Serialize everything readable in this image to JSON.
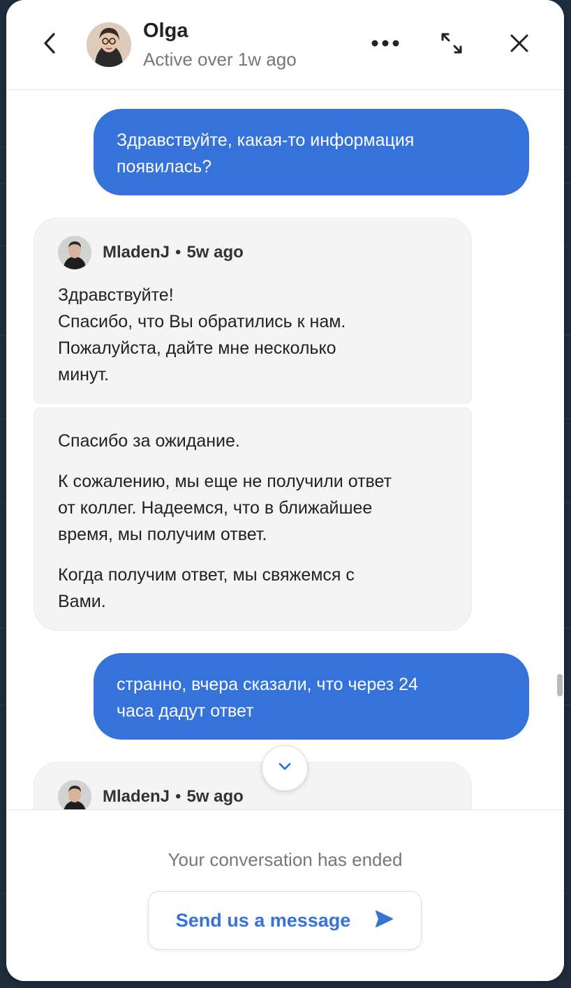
{
  "header": {
    "name": "Olga",
    "status": "Active over 1w ago"
  },
  "messages": [
    {
      "direction": "outgoing",
      "lines": [
        "Здравствуйте, какая-то информация",
        "появилась?"
      ]
    },
    {
      "direction": "incoming",
      "sender": "MladenJ",
      "separator": "•",
      "time": "5w ago",
      "lines": [
        "Здравствуйте!",
        "Спасибо, что Вы обратились к нам.",
        "Пожалуйста, дайте мне несколько",
        "минут."
      ]
    },
    {
      "direction": "incoming",
      "paragraphs": [
        [
          "Спасибо за ожидание."
        ],
        [
          "К сожалению, мы еще не получили ответ",
          "от коллег. Надеемся, что в ближайшее",
          "время, мы получим ответ."
        ],
        [
          "Когда получим ответ, мы свяжемся с",
          "Вами."
        ]
      ]
    },
    {
      "direction": "outgoing",
      "lines": [
        "странно, вчера сказали, что через 24",
        "часа дадут ответ"
      ]
    },
    {
      "direction": "incoming",
      "sender": "MladenJ",
      "separator": "•",
      "time": "5w ago"
    }
  ],
  "footer": {
    "ended_text": "Your conversation has ended",
    "send_label": "Send us a message"
  },
  "icons": {
    "back": "chevron-left-icon",
    "more": "more-horizontal-icon",
    "expand": "expand-icon",
    "close": "close-icon",
    "scroll_down": "chevron-down-icon",
    "send": "send-arrow-icon"
  },
  "colors": {
    "accent": "#3573da",
    "incoming_bubble": "#f4f4f4"
  }
}
